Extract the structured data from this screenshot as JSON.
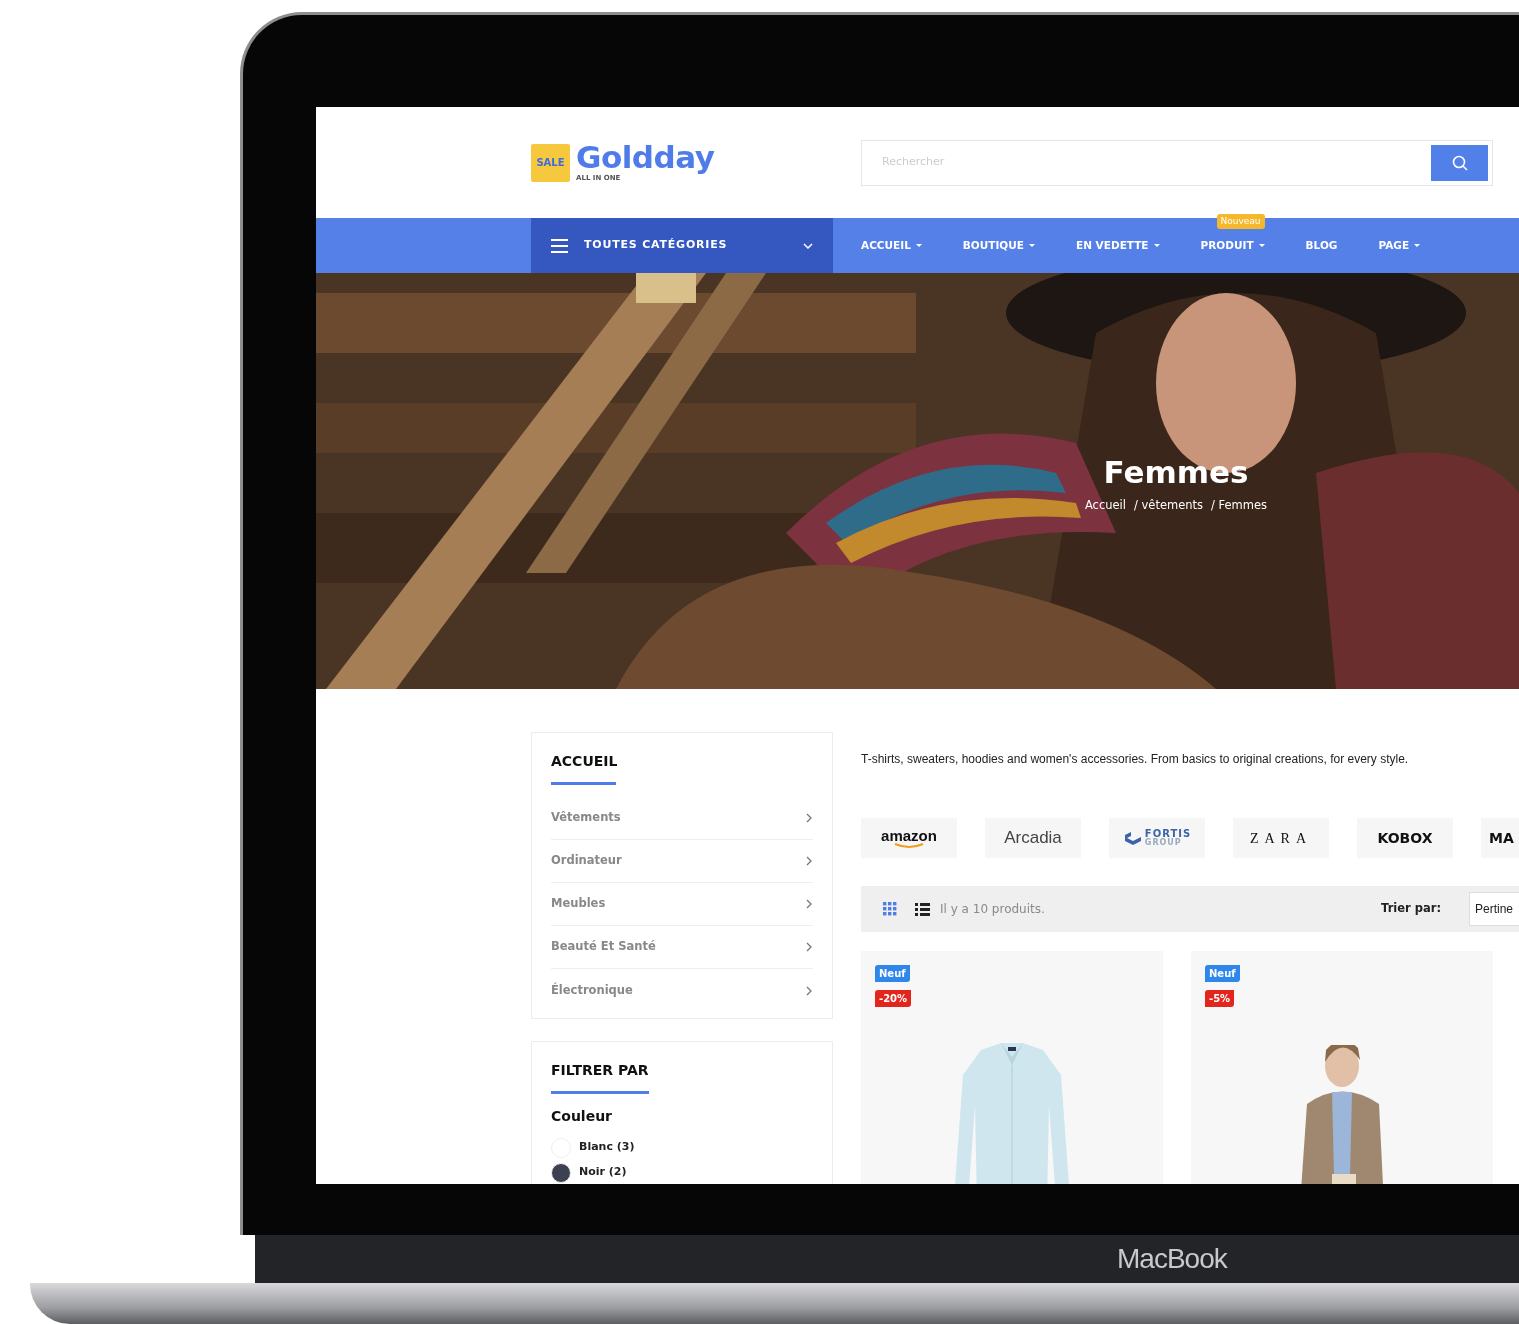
{
  "logo": {
    "badge": "SALE",
    "name": "Goldday",
    "tagline": "ALL IN ONE"
  },
  "search": {
    "placeholder": "Rechercher"
  },
  "nav": {
    "categories_label": "TOUTES CATÉGORIES",
    "items": [
      {
        "label": "ACCUEIL",
        "dropdown": true
      },
      {
        "label": "BOUTIQUE",
        "dropdown": true
      },
      {
        "label": "EN VEDETTE",
        "dropdown": true
      },
      {
        "label": "PRODUIT",
        "dropdown": true,
        "badge": "Nouveau"
      },
      {
        "label": "BLOG",
        "dropdown": false
      },
      {
        "label": "PAGE",
        "dropdown": true
      }
    ]
  },
  "hero": {
    "kind": "picture",
    "title": "Femmes",
    "breadcrumb": [
      "Accueil",
      "/ vêtements",
      "/ Femmes"
    ]
  },
  "sidebar": {
    "title": "ACCUEIL",
    "items": [
      {
        "label": "Vêtements"
      },
      {
        "label": "Ordinateur"
      },
      {
        "label": "Meubles"
      },
      {
        "label": "Beauté Et Santé"
      },
      {
        "label": "Électronique"
      }
    ]
  },
  "filter": {
    "title": "FILTRER PAR",
    "group": "Couleur",
    "options": [
      {
        "label": "Blanc (3)",
        "color": "#ffffff",
        "checked": false
      },
      {
        "label": "Noir (2)",
        "color": "#3b4150",
        "checked": false
      }
    ]
  },
  "description": "T-shirts, sweaters, hoodies and women's accessories. From basics to original creations, for every style.",
  "brands": [
    {
      "name": "amazon",
      "kind": "smile"
    },
    {
      "name": "Arcadia",
      "kind": "light"
    },
    {
      "name": "FORTIS",
      "sub": "GROUP",
      "kind": "emblem"
    },
    {
      "name": "ZARA",
      "kind": "spaced"
    },
    {
      "name": "KOBOX",
      "kind": "bold"
    },
    {
      "name": "MA",
      "kind": "bold"
    }
  ],
  "toolbar": {
    "count": "Il y a 10 produits.",
    "sort_label": "Trier par:",
    "sort_value": "Pertine"
  },
  "products": [
    {
      "kind": "shirt",
      "badges": [
        {
          "label": "Neuf",
          "kind": "new"
        },
        {
          "label": "-20%",
          "kind": "discount"
        }
      ]
    },
    {
      "kind": "model",
      "badges": [
        {
          "label": "Neuf",
          "kind": "new"
        },
        {
          "label": "-5%",
          "kind": "discount"
        }
      ]
    }
  ],
  "device_label": "MacBook"
}
